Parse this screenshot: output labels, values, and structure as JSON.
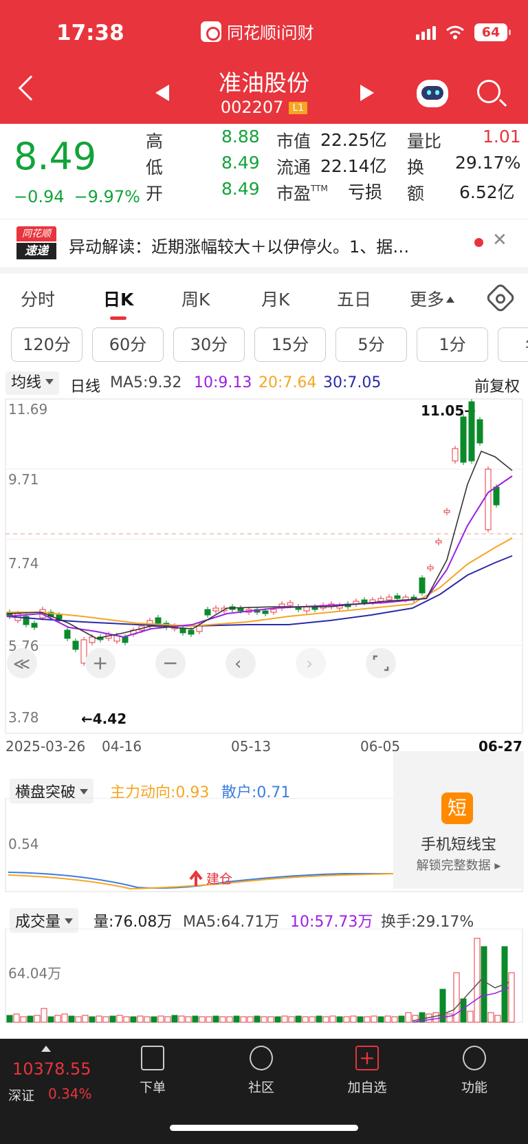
{
  "status": {
    "time": "17:38",
    "app": "同花顺i问财",
    "battery": "64"
  },
  "stock": {
    "name": "准油股份",
    "code": "002207",
    "level": "L1"
  },
  "quote": {
    "price": "8.49",
    "change": "−0.94",
    "change_pct": "−9.97%",
    "high_label": "高",
    "high": "8.88",
    "low_label": "低",
    "low": "8.49",
    "open_label": "开",
    "open": "8.49",
    "mcap_label": "市值",
    "mcap": "22.25亿",
    "float_label": "流通",
    "float": "22.14亿",
    "pe_label": "市盈",
    "pe_sup": "TTM",
    "pe": "亏损",
    "vr_label": "量比",
    "vr": "1.01",
    "turn_label": "换",
    "turn": "29.17%",
    "amt_label": "额",
    "amt": "6.52亿"
  },
  "news": {
    "logo_top": "同花顺",
    "logo_bottom": "速递",
    "text": "异动解读：近期涨幅较大＋以伊停火。1、据…"
  },
  "tabs": [
    "分时",
    "日K",
    "周K",
    "月K",
    "五日",
    "更多"
  ],
  "periods": [
    "120分",
    "60分",
    "30分",
    "15分",
    "5分",
    "1分",
    "年"
  ],
  "ma": {
    "selector": "均线",
    "line": "日线",
    "ma5": "MA5:9.32",
    "ma10": "10:9.13",
    "ma20": "20:7.64",
    "ma30": "30:7.05",
    "adjust": "前复权"
  },
  "chart_data": {
    "type": "candlestick",
    "ylim": [
      3.78,
      11.69
    ],
    "y_ticks": [
      "11.69",
      "9.71",
      "7.74",
      "5.76",
      "3.78"
    ],
    "x_ticks": [
      "2025-03-26",
      "04-16",
      "05-13",
      "06-05",
      "06-27"
    ],
    "annotations": {
      "high": "11.05→",
      "low": "←4.42"
    },
    "last_price": 8.49,
    "colors": {
      "up": "#e8343c",
      "down": "#0b8a2a",
      "ma5": "#333333",
      "ma10": "#9b1ee6",
      "ma20": "#f5a623",
      "ma30": "#2a2aa8"
    }
  },
  "indicator": {
    "selector": "横盘突破",
    "main": "主力动向:0.93",
    "retail": "散户:0.71",
    "tick": "0.54",
    "signal": "建仓"
  },
  "promo": {
    "icon": "短",
    "title": "手机短线宝",
    "subtitle": "解锁完整数据"
  },
  "volume": {
    "selector": "成交量",
    "vol": "量:76.08万",
    "ma5": "MA5:64.71万",
    "ma10": "10:57.73万",
    "turnover": "换手:29.17%",
    "tick": "64.04万"
  },
  "bottom": {
    "index_value": "10378.55",
    "index_name": "深证",
    "index_pct": "0.34%",
    "nav": [
      "下单",
      "社区",
      "加自选",
      "功能"
    ]
  }
}
